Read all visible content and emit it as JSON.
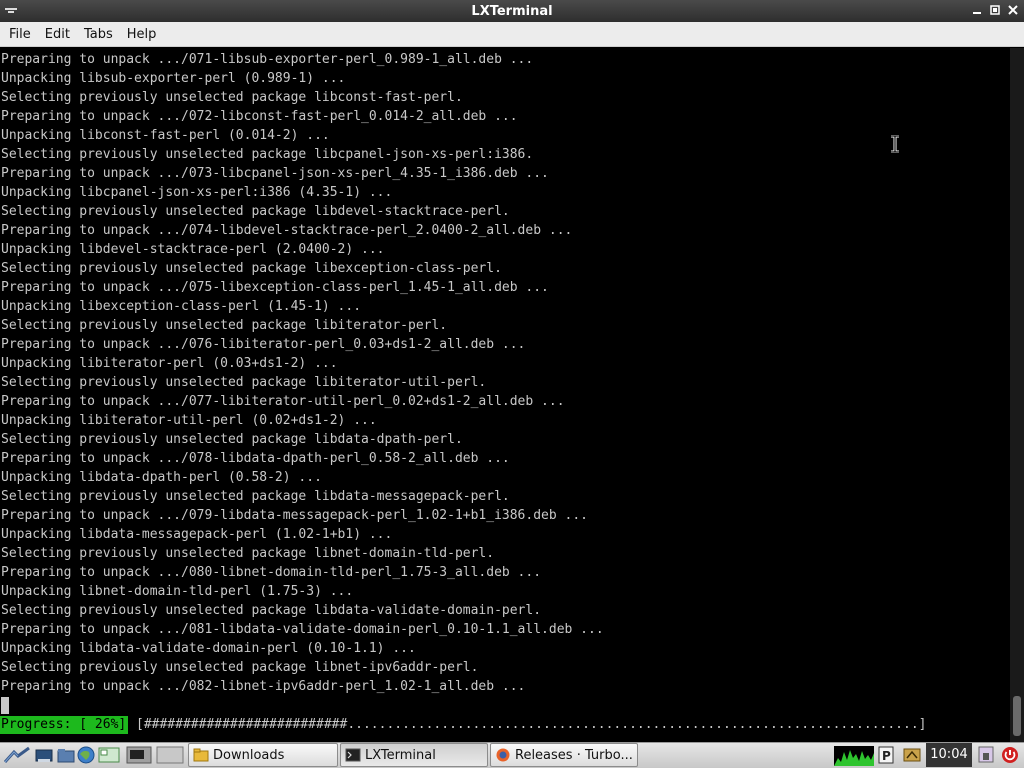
{
  "window": {
    "title": "LXTerminal"
  },
  "menu": [
    "File",
    "Edit",
    "Tabs",
    "Help"
  ],
  "terminal_lines": [
    "Preparing to unpack .../071-libsub-exporter-perl_0.989-1_all.deb ...",
    "Unpacking libsub-exporter-perl (0.989-1) ...",
    "Selecting previously unselected package libconst-fast-perl.",
    "Preparing to unpack .../072-libconst-fast-perl_0.014-2_all.deb ...",
    "Unpacking libconst-fast-perl (0.014-2) ...",
    "Selecting previously unselected package libcpanel-json-xs-perl:i386.",
    "Preparing to unpack .../073-libcpanel-json-xs-perl_4.35-1_i386.deb ...",
    "Unpacking libcpanel-json-xs-perl:i386 (4.35-1) ...",
    "Selecting previously unselected package libdevel-stacktrace-perl.",
    "Preparing to unpack .../074-libdevel-stacktrace-perl_2.0400-2_all.deb ...",
    "Unpacking libdevel-stacktrace-perl (2.0400-2) ...",
    "Selecting previously unselected package libexception-class-perl.",
    "Preparing to unpack .../075-libexception-class-perl_1.45-1_all.deb ...",
    "Unpacking libexception-class-perl (1.45-1) ...",
    "Selecting previously unselected package libiterator-perl.",
    "Preparing to unpack .../076-libiterator-perl_0.03+ds1-2_all.deb ...",
    "Unpacking libiterator-perl (0.03+ds1-2) ...",
    "Selecting previously unselected package libiterator-util-perl.",
    "Preparing to unpack .../077-libiterator-util-perl_0.02+ds1-2_all.deb ...",
    "Unpacking libiterator-util-perl (0.02+ds1-2) ...",
    "Selecting previously unselected package libdata-dpath-perl.",
    "Preparing to unpack .../078-libdata-dpath-perl_0.58-2_all.deb ...",
    "Unpacking libdata-dpath-perl (0.58-2) ...",
    "Selecting previously unselected package libdata-messagepack-perl.",
    "Preparing to unpack .../079-libdata-messagepack-perl_1.02-1+b1_i386.deb ...",
    "Unpacking libdata-messagepack-perl (1.02-1+b1) ...",
    "Selecting previously unselected package libnet-domain-tld-perl.",
    "Preparing to unpack .../080-libnet-domain-tld-perl_1.75-3_all.deb ...",
    "Unpacking libnet-domain-tld-perl (1.75-3) ...",
    "Selecting previously unselected package libdata-validate-domain-perl.",
    "Preparing to unpack .../081-libdata-validate-domain-perl_0.10-1.1_all.deb ...",
    "Unpacking libdata-validate-domain-perl (0.10-1.1) ...",
    "Selecting previously unselected package libnet-ipv6addr-perl.",
    "Preparing to unpack .../082-libnet-ipv6addr-perl_1.02-1_all.deb ..."
  ],
  "progress": {
    "label": "Progress: [ 26%]",
    "bar": "[##########################.........................................................................]",
    "percent": 26
  },
  "taskbar": {
    "tasks": [
      {
        "label": "Downloads",
        "icon": "folder-icon"
      },
      {
        "label": "LXTerminal",
        "icon": "terminal-icon"
      },
      {
        "label": "Releases · Turbo...",
        "icon": "firefox-icon"
      }
    ],
    "clock": "10:04"
  }
}
